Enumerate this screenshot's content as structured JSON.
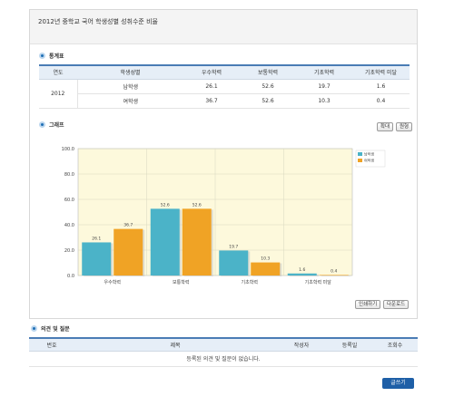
{
  "page_title": "2012년 중학교 국어 학생성별 성취수준 비율",
  "stat_section": "통계표",
  "stat_table": {
    "headers": [
      "연도",
      "학생성별",
      "우수학력",
      "보통학력",
      "기초학력",
      "기초학력 미달"
    ],
    "year": "2012",
    "rows": [
      {
        "gender": "남학생",
        "values": [
          "26.1",
          "52.6",
          "19.7",
          "1.6"
        ]
      },
      {
        "gender": "여학생",
        "values": [
          "36.7",
          "52.6",
          "10.3",
          "0.4"
        ]
      }
    ]
  },
  "graph_section": "그래프",
  "zoom_buttons": {
    "enlarge": "확대",
    "original": "원형"
  },
  "print_buttons": {
    "print": "인쇄하기",
    "download": "다운로드"
  },
  "chart_data": {
    "type": "bar",
    "categories": [
      "우수학력",
      "보통학력",
      "기초학력",
      "기초학력 미달"
    ],
    "series": [
      {
        "name": "남학생",
        "values": [
          26.1,
          52.6,
          19.7,
          1.6
        ],
        "color": "#4bb3c8"
      },
      {
        "name": "여학생",
        "values": [
          36.7,
          52.6,
          10.3,
          0.4
        ],
        "color": "#f0a325"
      }
    ],
    "ylim": [
      0,
      100
    ],
    "yticks": [
      "0.0",
      "20.0",
      "40.0",
      "60.0",
      "80.0",
      "100.0"
    ],
    "grid": true,
    "legend": "top-right",
    "value_labels": [
      [
        "26.1",
        "52.6",
        "19.7",
        "1.6"
      ],
      [
        "36.7",
        "52.6",
        "10.3",
        "0.4"
      ]
    ]
  },
  "comments_section": "의견 및 질문",
  "board": {
    "headers": [
      "번호",
      "제목",
      "작성자",
      "등록일",
      "조회수"
    ],
    "empty_message": "등록된 의견 및 질문이 없습니다."
  },
  "write_button": "글쓰기"
}
